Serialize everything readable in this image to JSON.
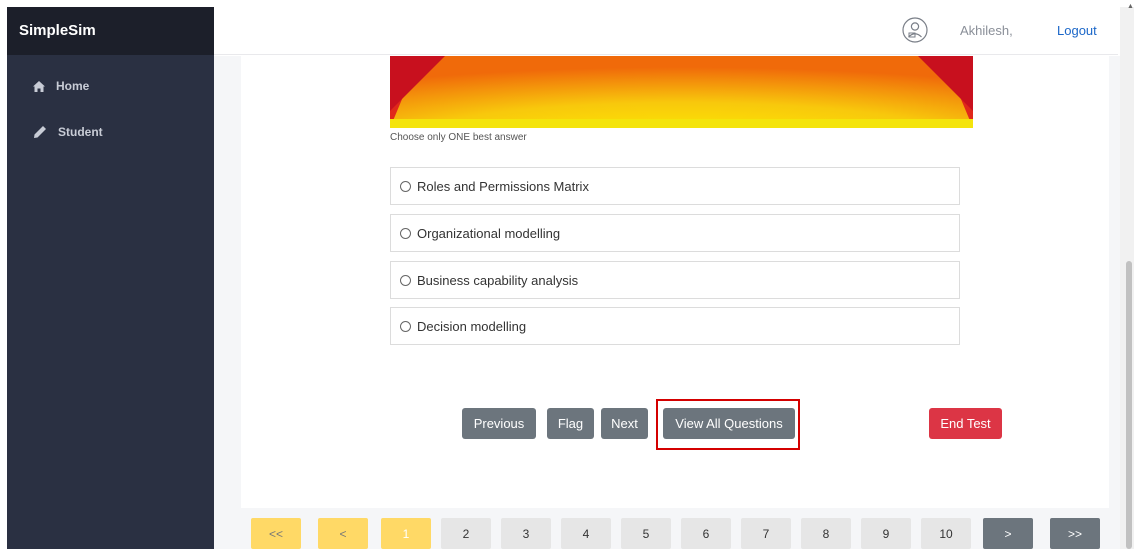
{
  "sidebar": {
    "brand": "SimpleSim",
    "items": [
      {
        "label": "Home",
        "icon": "home-icon"
      },
      {
        "label": "Student",
        "icon": "pencil-icon"
      }
    ]
  },
  "header": {
    "avatar_icon": "user-avatar-icon",
    "username": "Akhilesh,",
    "logout_label": "Logout"
  },
  "question": {
    "instruction": "Choose only ONE best answer",
    "options": [
      "Roles and Permissions Matrix",
      "Organizational modelling",
      "Business capability analysis",
      "Decision modelling"
    ]
  },
  "actions": {
    "previous": "Previous",
    "flag": "Flag",
    "next": "Next",
    "view_all": "View All Questions",
    "end_test": "End Test"
  },
  "pagination": {
    "first": "<<",
    "prev": "<",
    "pages": [
      "1",
      "2",
      "3",
      "4",
      "5",
      "6",
      "7",
      "8",
      "9",
      "10"
    ],
    "current": "1",
    "next": ">",
    "last": ">>"
  },
  "colors": {
    "sidebar": "#2a3042",
    "brand_bar": "#1c1f2a",
    "button_gray": "#6c757d",
    "button_red": "#dc3545",
    "pager_yellow": "#ffd966",
    "highlight_red": "#d40000"
  }
}
